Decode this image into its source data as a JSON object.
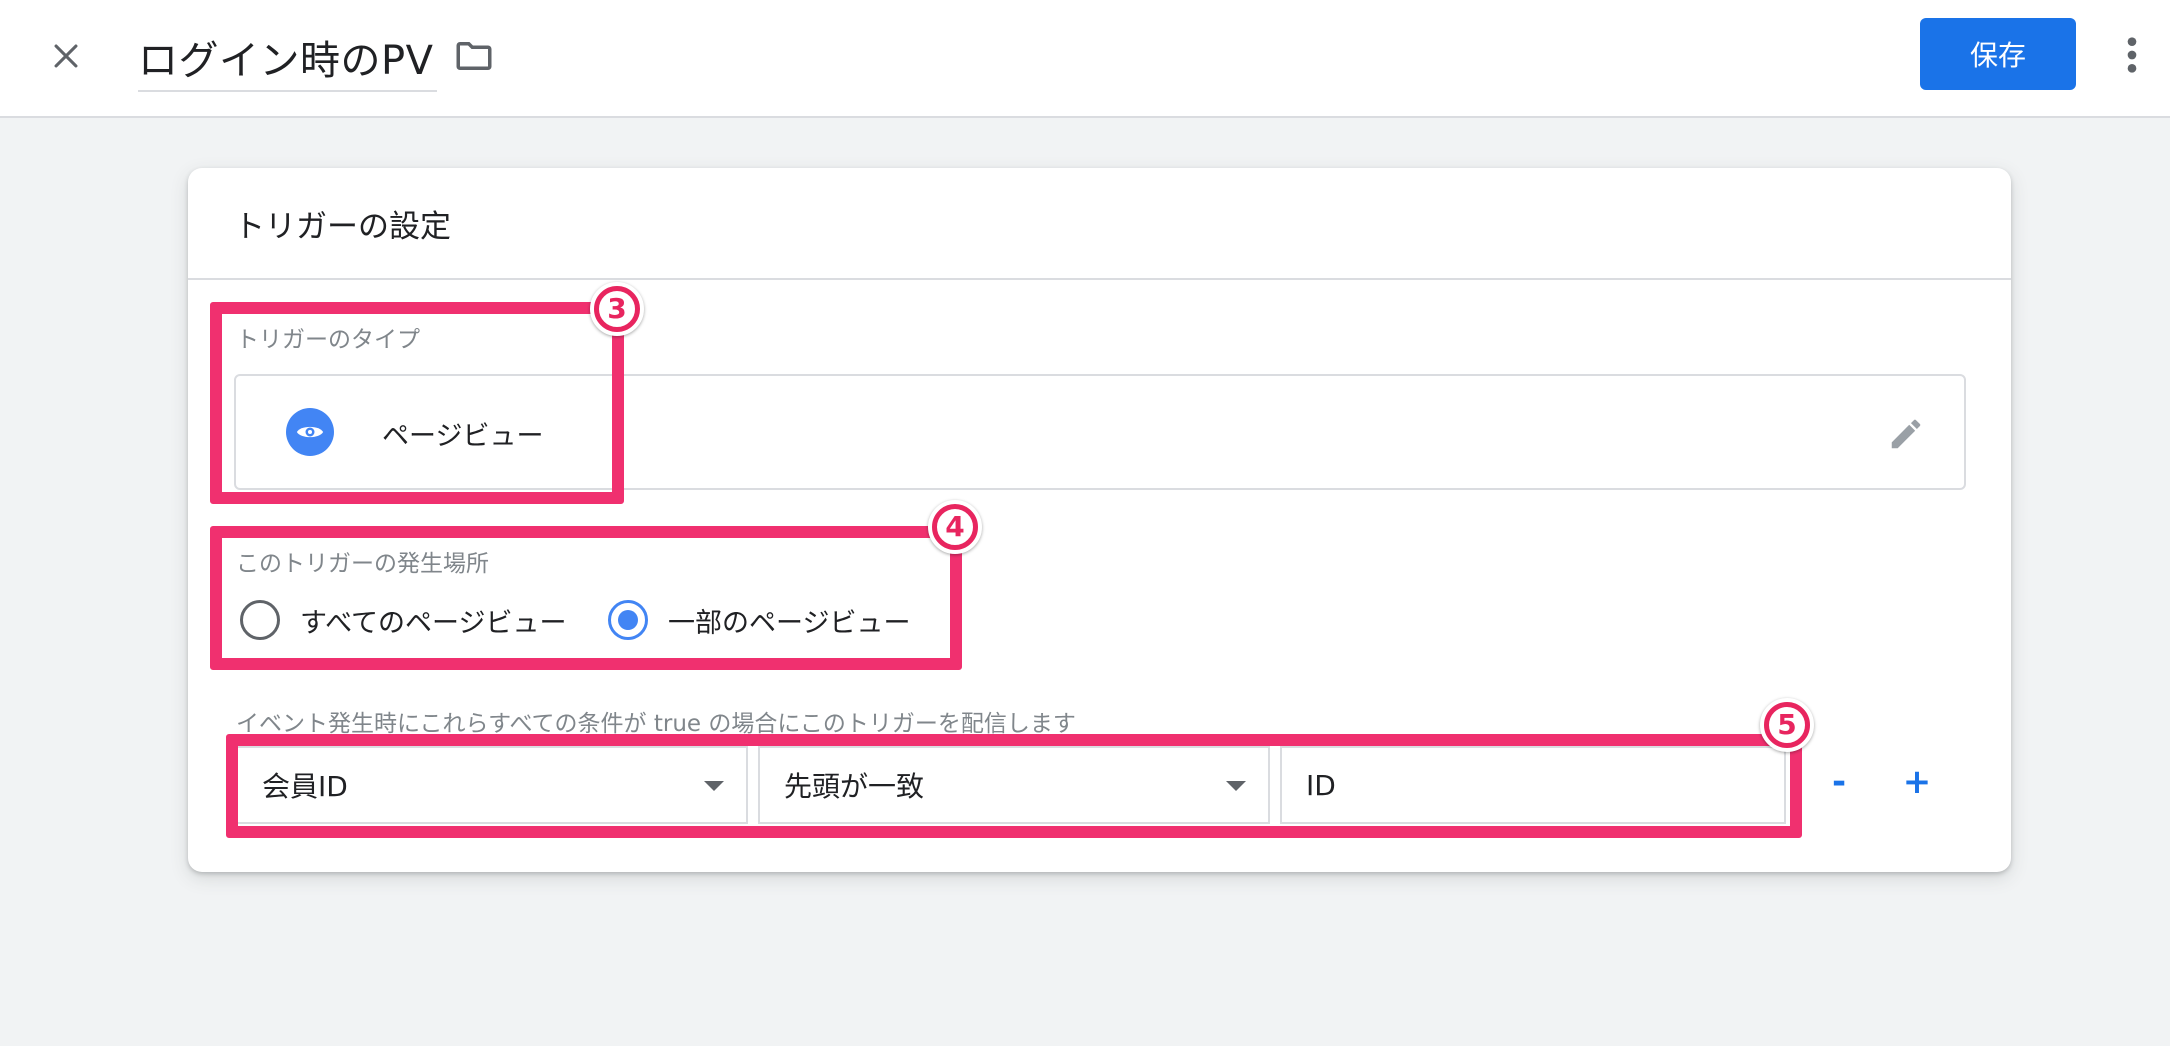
{
  "topbar": {
    "close_icon": "close-icon",
    "title": "ログイン時のPV",
    "folder_icon": "folder-icon",
    "save_label": "保存",
    "more_icon": "more-vert-icon"
  },
  "card": {
    "title": "トリガーの設定",
    "trigger_type": {
      "label": "トリガーのタイプ",
      "value": "ページビュー",
      "icon": "eye-icon",
      "edit_icon": "pencil-icon"
    },
    "fire_on": {
      "label": "このトリガーの発生場所",
      "options": [
        {
          "label": "すべてのページビュー",
          "selected": false
        },
        {
          "label": "一部のページビュー",
          "selected": true
        }
      ]
    },
    "conditions": {
      "label": "イベント発生時にこれらすべての条件が true の場合にこのトリガーを配信します",
      "variable": "会員ID",
      "operator": "先頭が一致",
      "value": "ID",
      "remove_label": "-",
      "add_label": "+"
    }
  },
  "annotations": {
    "badges": [
      "3",
      "4",
      "5"
    ],
    "color": "#f0306f"
  },
  "colors": {
    "accent": "#1a73e8",
    "radio_selected": "#4285f4",
    "background": "#f1f3f4"
  }
}
